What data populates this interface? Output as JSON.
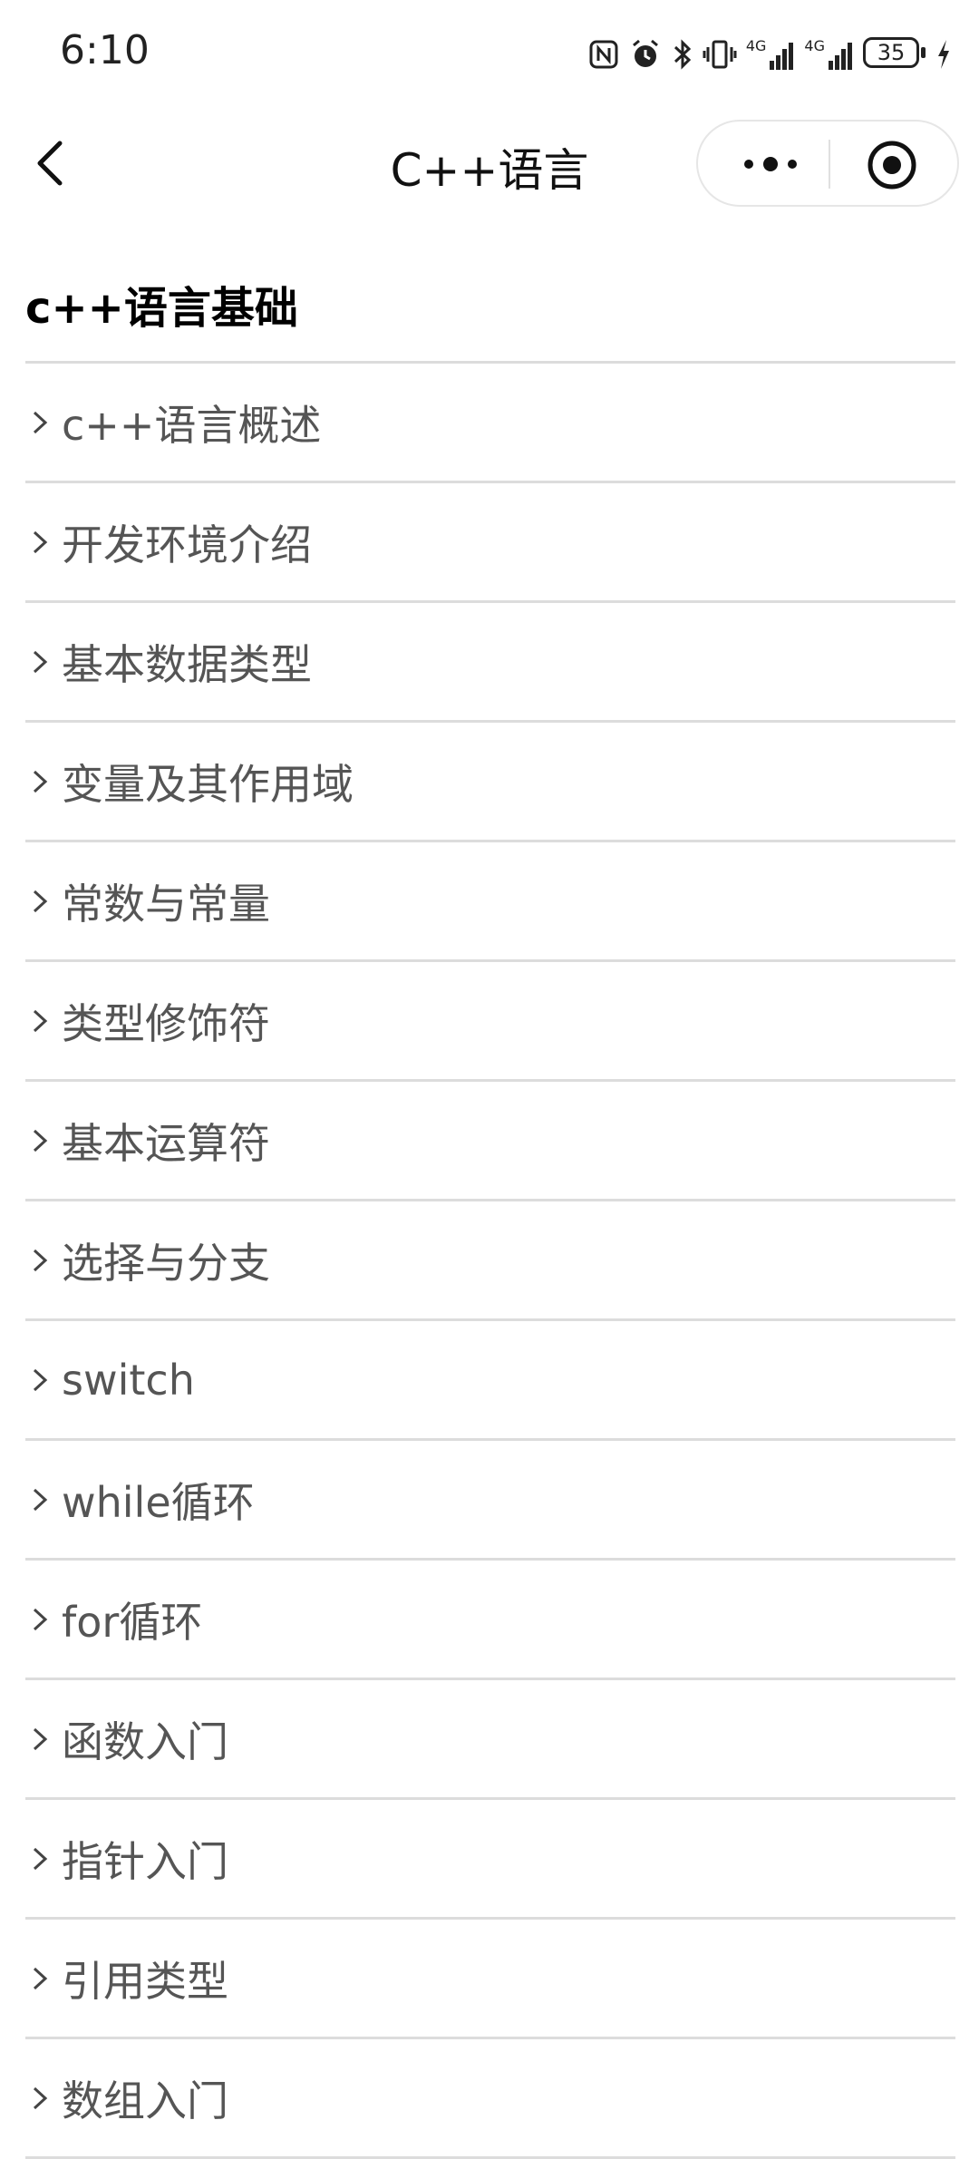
{
  "status_bar": {
    "time": "6:10",
    "battery": "35",
    "network_1": "4G",
    "network_2": "4G"
  },
  "nav": {
    "title": "C++语言"
  },
  "section": {
    "title": "c++语言基础"
  },
  "menu_items": [
    "c++语言概述",
    "开发环境介绍",
    "基本数据类型",
    "变量及其作用域",
    "常数与常量",
    "类型修饰符",
    "基本运算符",
    "选择与分支",
    "switch",
    "while循环",
    "for循环",
    "函数入门",
    "指针入门",
    "引用类型",
    "数组入门"
  ]
}
